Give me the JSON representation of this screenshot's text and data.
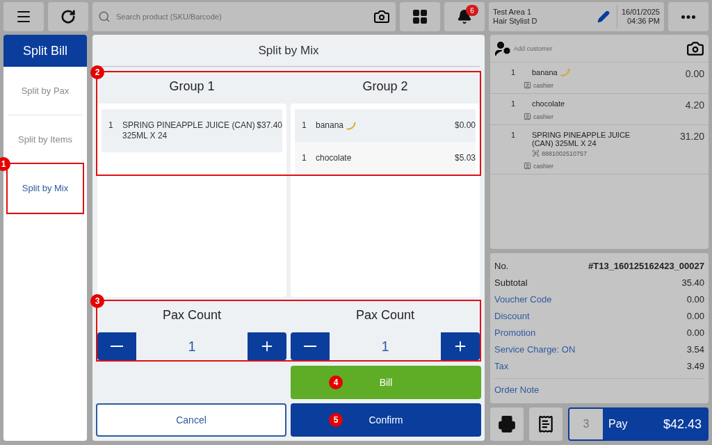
{
  "top_bar": {
    "search": {
      "placeholder": "Search product (SKU/Barcode)"
    },
    "notifications": {
      "count": "6"
    },
    "location": {
      "area": "Test Area 1",
      "staff": "Hair Stylist D"
    },
    "date": "16/01/2025",
    "time": "04:36 PM"
  },
  "sidebar": {
    "title": "Split Bill",
    "items": [
      {
        "label": "Split by Pax",
        "selected": false
      },
      {
        "label": "Split by Items",
        "selected": false
      },
      {
        "label": "Split by Mix",
        "selected": true,
        "callout": "1"
      }
    ]
  },
  "split_dialog": {
    "title": "Split by Mix",
    "groups_callout": "2",
    "pax_callout": "3",
    "groups": [
      {
        "name": "Group 1",
        "items": [
          {
            "qty": "1",
            "name": "SPRING PINEAPPLE JUICE (CAN) 325ML X 24",
            "has_icon": false,
            "price": "$37.40"
          }
        ],
        "pax_label": "Pax Count",
        "pax_value": "1"
      },
      {
        "name": "Group 2",
        "items": [
          {
            "qty": "1",
            "name": "banana",
            "has_icon": true,
            "price": "$0.00"
          },
          {
            "qty": "1",
            "name": "chocolate",
            "has_icon": false,
            "price": "$5.03"
          }
        ],
        "pax_label": "Pax Count",
        "pax_value": "1"
      }
    ],
    "bill_button": {
      "label": "Bill",
      "callout": "4"
    },
    "cancel_button": {
      "label": "Cancel"
    },
    "confirm_button": {
      "label": "Confirm",
      "callout": "5"
    }
  },
  "order": {
    "customer_placeholder": "Add customer",
    "items": [
      {
        "qty": "1",
        "name": "banana",
        "has_icon": true,
        "amount": "0.00",
        "staff": "cashier"
      },
      {
        "qty": "1",
        "name": "chocolate",
        "has_icon": false,
        "amount": "4.20",
        "staff": "cashier"
      },
      {
        "qty": "1",
        "name": "SPRING PINEAPPLE JUICE (CAN) 325ML X 24",
        "has_icon": false,
        "barcode": "8881002510757",
        "amount": "31.20",
        "staff": "cashier"
      }
    ],
    "summary": [
      {
        "label": "No.",
        "value": "#T13_160125162423_00027",
        "kind": "plain",
        "bold_value": true
      },
      {
        "label": "Subtotal",
        "value": "35.40",
        "kind": "plain",
        "bold_value": false
      },
      {
        "label": "Voucher Code",
        "value": "0.00",
        "kind": "link",
        "bold_value": false
      },
      {
        "label": "Discount",
        "value": "0.00",
        "kind": "link",
        "bold_value": false
      },
      {
        "label": "Promotion",
        "value": "0.00",
        "kind": "link",
        "bold_value": false
      },
      {
        "label": "Service Charge: ON",
        "value": "3.54",
        "kind": "link",
        "bold_value": false
      },
      {
        "label": "Tax",
        "value": "3.49",
        "kind": "link",
        "bold_value": false
      }
    ],
    "order_note": "Order Note",
    "pay": {
      "count": "3",
      "label": "Pay",
      "amount": "$42.43"
    }
  }
}
